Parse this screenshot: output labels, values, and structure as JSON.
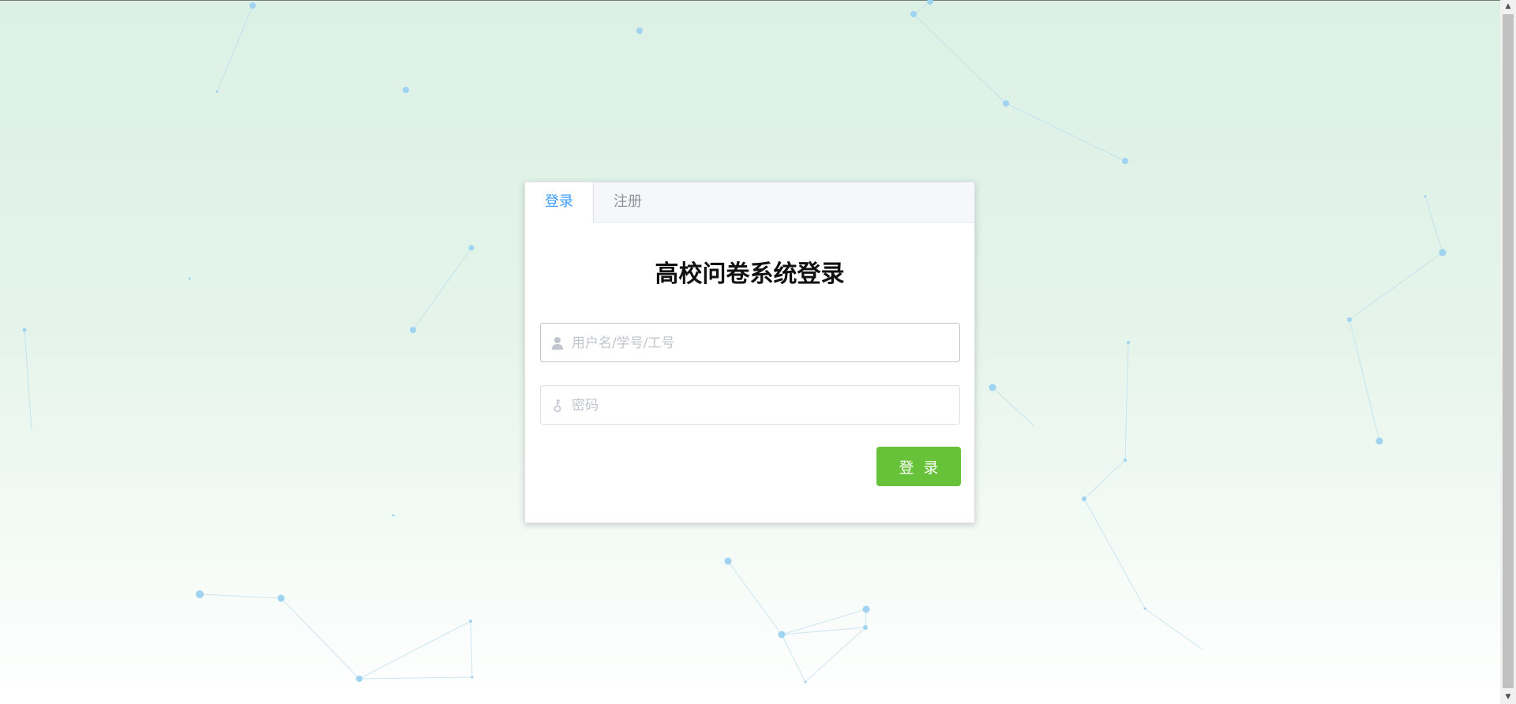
{
  "tabs": [
    {
      "label": "登录",
      "active": true
    },
    {
      "label": "注册",
      "active": false
    }
  ],
  "login": {
    "title": "高校问卷系统登录",
    "username_placeholder": "用户名/学号/工号",
    "username_value": "",
    "password_placeholder": "密码",
    "password_value": "",
    "submit_label": "登录"
  },
  "icons": {
    "username": "user-icon",
    "password": "key-icon"
  },
  "colors": {
    "tab_active": "#409eff",
    "submit_bg": "#67c23a",
    "particle": "#9fd3f0"
  }
}
